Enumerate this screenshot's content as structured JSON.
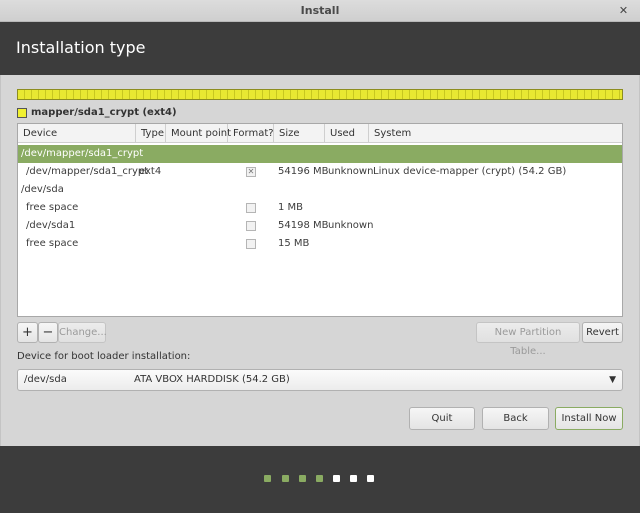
{
  "window": {
    "title": "Install",
    "close_glyph": "✕"
  },
  "header": {
    "title": "Installation type"
  },
  "partition_legend": {
    "label": "mapper/sda1_crypt (ext4)",
    "color": "#f0f030"
  },
  "table": {
    "columns": [
      "Device",
      "Type",
      "Mount point",
      "Format?",
      "Size",
      "Used",
      "System"
    ],
    "rows": [
      {
        "device": "/dev/mapper/sda1_crypt",
        "type": "",
        "mount": "",
        "format": "",
        "size": "",
        "used": "",
        "system": ""
      },
      {
        "device": "/dev/mapper/sda1_crypt",
        "type": "ext4",
        "mount": "",
        "format": "✕",
        "size": "54196 MB",
        "used": "unknown",
        "system": "Linux device-mapper (crypt) (54.2 GB)"
      },
      {
        "device": "/dev/sda",
        "type": "",
        "mount": "",
        "format": "",
        "size": "",
        "used": "",
        "system": ""
      },
      {
        "device": "free space",
        "type": "",
        "mount": "",
        "format": "",
        "size": "1 MB",
        "used": "",
        "system": ""
      },
      {
        "device": "/dev/sda1",
        "type": "",
        "mount": "",
        "format": "",
        "size": "54198 MB",
        "used": "unknown",
        "system": ""
      },
      {
        "device": "free space",
        "type": "",
        "mount": "",
        "format": "",
        "size": "15 MB",
        "used": "",
        "system": ""
      }
    ]
  },
  "toolbar": {
    "add": "+",
    "remove": "−",
    "change": "Change...",
    "new_table": "New Partition Table...",
    "revert": "Revert"
  },
  "bootloader": {
    "label": "Device for boot loader installation:",
    "device": "/dev/sda",
    "description": "ATA VBOX HARDDISK (54.2 GB)",
    "arrow": "▼"
  },
  "actions": {
    "quit": "Quit",
    "back": "Back",
    "install": "Install Now"
  },
  "progress": {
    "completed_steps": 4,
    "total_steps": 7
  },
  "colors": {
    "accent": "#8aab62",
    "header_bg": "#3c3c3c"
  }
}
